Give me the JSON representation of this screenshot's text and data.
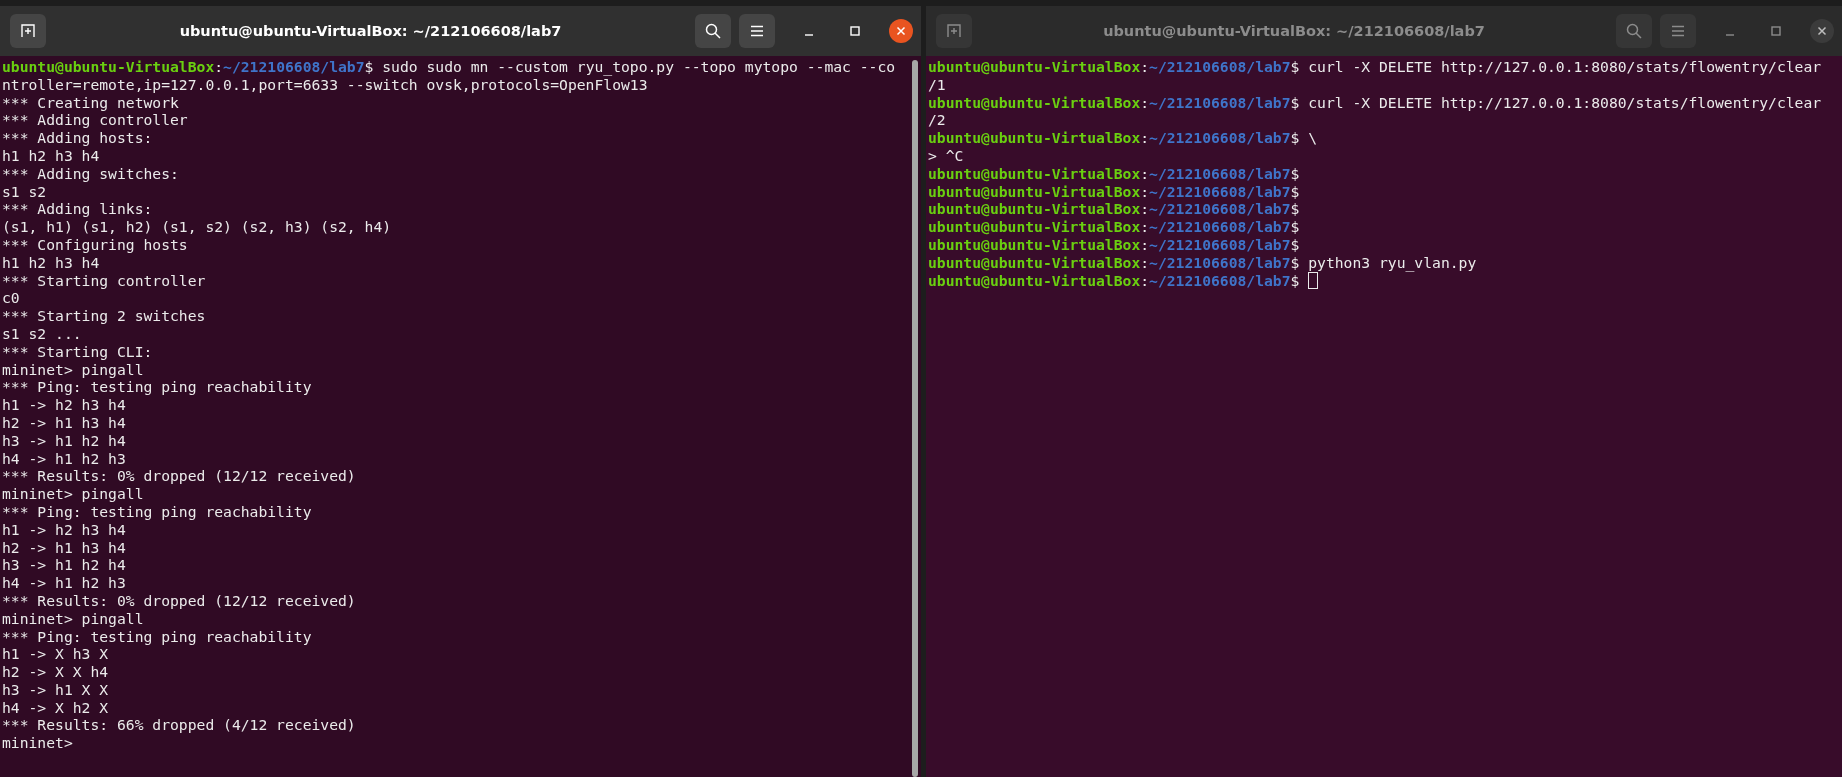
{
  "windows": [
    {
      "title": "ubuntu@ubuntu-VirtualBox: ~/212106608/lab7",
      "active": true,
      "lines": [
        [
          {
            "kind": "user",
            "text": "ubuntu@ubuntu-VirtualBox"
          },
          {
            "kind": "plain",
            "text": ":"
          },
          {
            "kind": "path",
            "text": "~/212106608/lab7"
          },
          {
            "kind": "plain",
            "text": "$ sudo sudo mn --custom ryu_topo.py --topo mytopo --mac --co"
          }
        ],
        [
          {
            "kind": "plain",
            "text": "ntroller=remote,ip=127.0.0.1,port=6633 --switch ovsk,protocols=OpenFlow13"
          }
        ],
        [
          {
            "kind": "plain",
            "text": "*** Creating network"
          }
        ],
        [
          {
            "kind": "plain",
            "text": "*** Adding controller"
          }
        ],
        [
          {
            "kind": "plain",
            "text": "*** Adding hosts:"
          }
        ],
        [
          {
            "kind": "plain",
            "text": "h1 h2 h3 h4"
          }
        ],
        [
          {
            "kind": "plain",
            "text": "*** Adding switches:"
          }
        ],
        [
          {
            "kind": "plain",
            "text": "s1 s2"
          }
        ],
        [
          {
            "kind": "plain",
            "text": "*** Adding links:"
          }
        ],
        [
          {
            "kind": "plain",
            "text": "(s1, h1) (s1, h2) (s1, s2) (s2, h3) (s2, h4)"
          }
        ],
        [
          {
            "kind": "plain",
            "text": "*** Configuring hosts"
          }
        ],
        [
          {
            "kind": "plain",
            "text": "h1 h2 h3 h4"
          }
        ],
        [
          {
            "kind": "plain",
            "text": "*** Starting controller"
          }
        ],
        [
          {
            "kind": "plain",
            "text": "c0"
          }
        ],
        [
          {
            "kind": "plain",
            "text": "*** Starting 2 switches"
          }
        ],
        [
          {
            "kind": "plain",
            "text": "s1 s2 ..."
          }
        ],
        [
          {
            "kind": "plain",
            "text": "*** Starting CLI:"
          }
        ],
        [
          {
            "kind": "plain",
            "text": "mininet> pingall"
          }
        ],
        [
          {
            "kind": "plain",
            "text": "*** Ping: testing ping reachability"
          }
        ],
        [
          {
            "kind": "plain",
            "text": "h1 -> h2 h3 h4"
          }
        ],
        [
          {
            "kind": "plain",
            "text": "h2 -> h1 h3 h4"
          }
        ],
        [
          {
            "kind": "plain",
            "text": "h3 -> h1 h2 h4"
          }
        ],
        [
          {
            "kind": "plain",
            "text": "h4 -> h1 h2 h3"
          }
        ],
        [
          {
            "kind": "plain",
            "text": "*** Results: 0% dropped (12/12 received)"
          }
        ],
        [
          {
            "kind": "plain",
            "text": "mininet> pingall"
          }
        ],
        [
          {
            "kind": "plain",
            "text": "*** Ping: testing ping reachability"
          }
        ],
        [
          {
            "kind": "plain",
            "text": "h1 -> h2 h3 h4"
          }
        ],
        [
          {
            "kind": "plain",
            "text": "h2 -> h1 h3 h4"
          }
        ],
        [
          {
            "kind": "plain",
            "text": "h3 -> h1 h2 h4"
          }
        ],
        [
          {
            "kind": "plain",
            "text": "h4 -> h1 h2 h3"
          }
        ],
        [
          {
            "kind": "plain",
            "text": "*** Results: 0% dropped (12/12 received)"
          }
        ],
        [
          {
            "kind": "plain",
            "text": "mininet> pingall"
          }
        ],
        [
          {
            "kind": "plain",
            "text": "*** Ping: testing ping reachability"
          }
        ],
        [
          {
            "kind": "plain",
            "text": "h1 -> X h3 X"
          }
        ],
        [
          {
            "kind": "plain",
            "text": "h2 -> X X h4"
          }
        ],
        [
          {
            "kind": "plain",
            "text": "h3 -> h1 X X"
          }
        ],
        [
          {
            "kind": "plain",
            "text": "h4 -> X h2 X"
          }
        ],
        [
          {
            "kind": "plain",
            "text": "*** Results: 66% dropped (4/12 received)"
          }
        ],
        [
          {
            "kind": "plain",
            "text": "mininet>"
          }
        ]
      ]
    },
    {
      "title": "ubuntu@ubuntu-VirtualBox: ~/212106608/lab7",
      "active": false,
      "lines": [
        [
          {
            "kind": "user",
            "text": "ubuntu@ubuntu-VirtualBox"
          },
          {
            "kind": "plain",
            "text": ":"
          },
          {
            "kind": "path",
            "text": "~/212106608/lab7"
          },
          {
            "kind": "plain",
            "text": "$ curl -X DELETE http://127.0.0.1:8080/stats/flowentry/clear"
          }
        ],
        [
          {
            "kind": "plain",
            "text": "/1"
          }
        ],
        [
          {
            "kind": "user",
            "text": "ubuntu@ubuntu-VirtualBox"
          },
          {
            "kind": "plain",
            "text": ":"
          },
          {
            "kind": "path",
            "text": "~/212106608/lab7"
          },
          {
            "kind": "plain",
            "text": "$ curl -X DELETE http://127.0.0.1:8080/stats/flowentry/clear"
          }
        ],
        [
          {
            "kind": "plain",
            "text": "/2"
          }
        ],
        [
          {
            "kind": "user",
            "text": "ubuntu@ubuntu-VirtualBox"
          },
          {
            "kind": "plain",
            "text": ":"
          },
          {
            "kind": "path",
            "text": "~/212106608/lab7"
          },
          {
            "kind": "plain",
            "text": "$ \\"
          }
        ],
        [
          {
            "kind": "plain",
            "text": "> ^C"
          }
        ],
        [
          {
            "kind": "user",
            "text": "ubuntu@ubuntu-VirtualBox"
          },
          {
            "kind": "plain",
            "text": ":"
          },
          {
            "kind": "path",
            "text": "~/212106608/lab7"
          },
          {
            "kind": "plain",
            "text": "$"
          }
        ],
        [
          {
            "kind": "user",
            "text": "ubuntu@ubuntu-VirtualBox"
          },
          {
            "kind": "plain",
            "text": ":"
          },
          {
            "kind": "path",
            "text": "~/212106608/lab7"
          },
          {
            "kind": "plain",
            "text": "$"
          }
        ],
        [
          {
            "kind": "user",
            "text": "ubuntu@ubuntu-VirtualBox"
          },
          {
            "kind": "plain",
            "text": ":"
          },
          {
            "kind": "path",
            "text": "~/212106608/lab7"
          },
          {
            "kind": "plain",
            "text": "$"
          }
        ],
        [
          {
            "kind": "user",
            "text": "ubuntu@ubuntu-VirtualBox"
          },
          {
            "kind": "plain",
            "text": ":"
          },
          {
            "kind": "path",
            "text": "~/212106608/lab7"
          },
          {
            "kind": "plain",
            "text": "$"
          }
        ],
        [
          {
            "kind": "user",
            "text": "ubuntu@ubuntu-VirtualBox"
          },
          {
            "kind": "plain",
            "text": ":"
          },
          {
            "kind": "path",
            "text": "~/212106608/lab7"
          },
          {
            "kind": "plain",
            "text": "$"
          }
        ],
        [
          {
            "kind": "user",
            "text": "ubuntu@ubuntu-VirtualBox"
          },
          {
            "kind": "plain",
            "text": ":"
          },
          {
            "kind": "path",
            "text": "~/212106608/lab7"
          },
          {
            "kind": "plain",
            "text": "$ python3 ryu_vlan.py"
          }
        ],
        [
          {
            "kind": "user",
            "text": "ubuntu@ubuntu-VirtualBox"
          },
          {
            "kind": "plain",
            "text": ":"
          },
          {
            "kind": "path",
            "text": "~/212106608/lab7"
          },
          {
            "kind": "plain",
            "text": "$ "
          }
        ]
      ],
      "cursor": true
    }
  ]
}
